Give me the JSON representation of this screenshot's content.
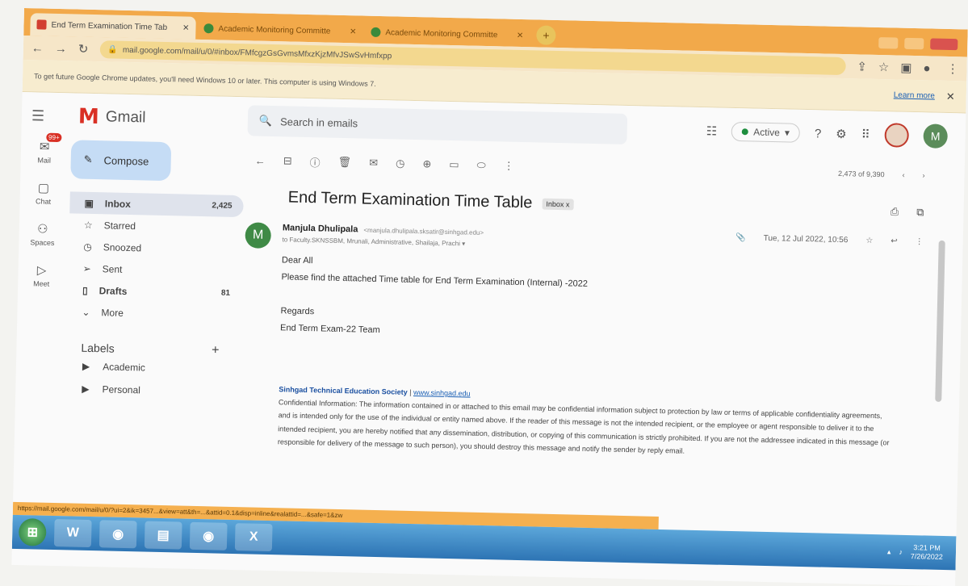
{
  "browser": {
    "tabs": [
      {
        "title": "End Term Examination Time Tab",
        "active": true
      },
      {
        "title": "Academic Monitoring Committe",
        "active": false
      },
      {
        "title": "Academic Monitoring Committe",
        "active": false
      }
    ],
    "new_tab": "+",
    "url": "mail.google.com/mail/u/0/#inbox/FMfcgzGsGvmsMfxzKjzMfvJSwSvHmfxpp",
    "infobar_text": "To get future Google Chrome updates, you'll need Windows 10 or later. This computer is using Windows 7.",
    "learn_more": "Learn more",
    "status_url": "https://mail.google.com/mail/u/0/?ui=2&ik=3457...&view=att&th=...&attid=0.1&disp=inline&realattid=...&safe=1&zw"
  },
  "gmail": {
    "product": "Gmail",
    "search_placeholder": "Search in emails",
    "status": "Active",
    "avatar_initial": "M",
    "rail": [
      {
        "label": "Mail",
        "badge": "99+"
      },
      {
        "label": "Chat"
      },
      {
        "label": "Spaces"
      },
      {
        "label": "Meet"
      }
    ],
    "compose_label": "Compose",
    "nav": [
      {
        "label": "Inbox",
        "count": "2,425",
        "icon": "inbox-icon"
      },
      {
        "label": "Starred",
        "count": "",
        "icon": "star-icon"
      },
      {
        "label": "Snoozed",
        "count": "",
        "icon": "clock-icon"
      },
      {
        "label": "Sent",
        "count": "",
        "icon": "send-icon"
      },
      {
        "label": "Drafts",
        "count": "81",
        "icon": "draft-icon"
      },
      {
        "label": "More",
        "count": "",
        "icon": "chevron-down-icon"
      }
    ],
    "labels_heading": "Labels",
    "labels": [
      "Academic",
      "Personal"
    ],
    "pager": "2,473 of 9,390",
    "email": {
      "subject": "End Term Examination Time Table",
      "chip": "Inbox x",
      "sender_name": "Manjula Dhulipala",
      "sender_email": "<manjula.dhulipala.sksatir@sinhgad.edu>",
      "to_line": "to Faculty.SKNSSBM, Mrunali, Administrative, Shailaja, Prachi",
      "date": "Tue, 12 Jul 2022, 10:56",
      "greeting": "Dear All",
      "body": "Please find the attached Time table for End Term Examination (Internal) -2022",
      "regards": "Regards",
      "team": "End Term Exam-22 Team",
      "org": "Sinhgad Technical Education Society",
      "org_site": "www.sinhgad.edu",
      "confidential": "Confidential Information: The information contained in or attached to this email may be confidential information subject to protection by law or terms of applicable confidentiality agreements, and is intended only for the use of the individual or entity named above. If the reader of this message is not the intended recipient, or the employee or agent responsible to deliver it to the intended recipient, you are hereby notified that any dissemination, distribution, or copying of this communication is strictly prohibited. If you are not the addressee indicated in this message (or responsible for delivery of the message to such person), you should destroy this message and notify the sender by reply email."
    }
  },
  "taskbar": {
    "apps": [
      "W",
      "◉",
      "▤",
      "◉",
      "X"
    ],
    "time": "3:21 PM",
    "date": "7/26/2022"
  }
}
